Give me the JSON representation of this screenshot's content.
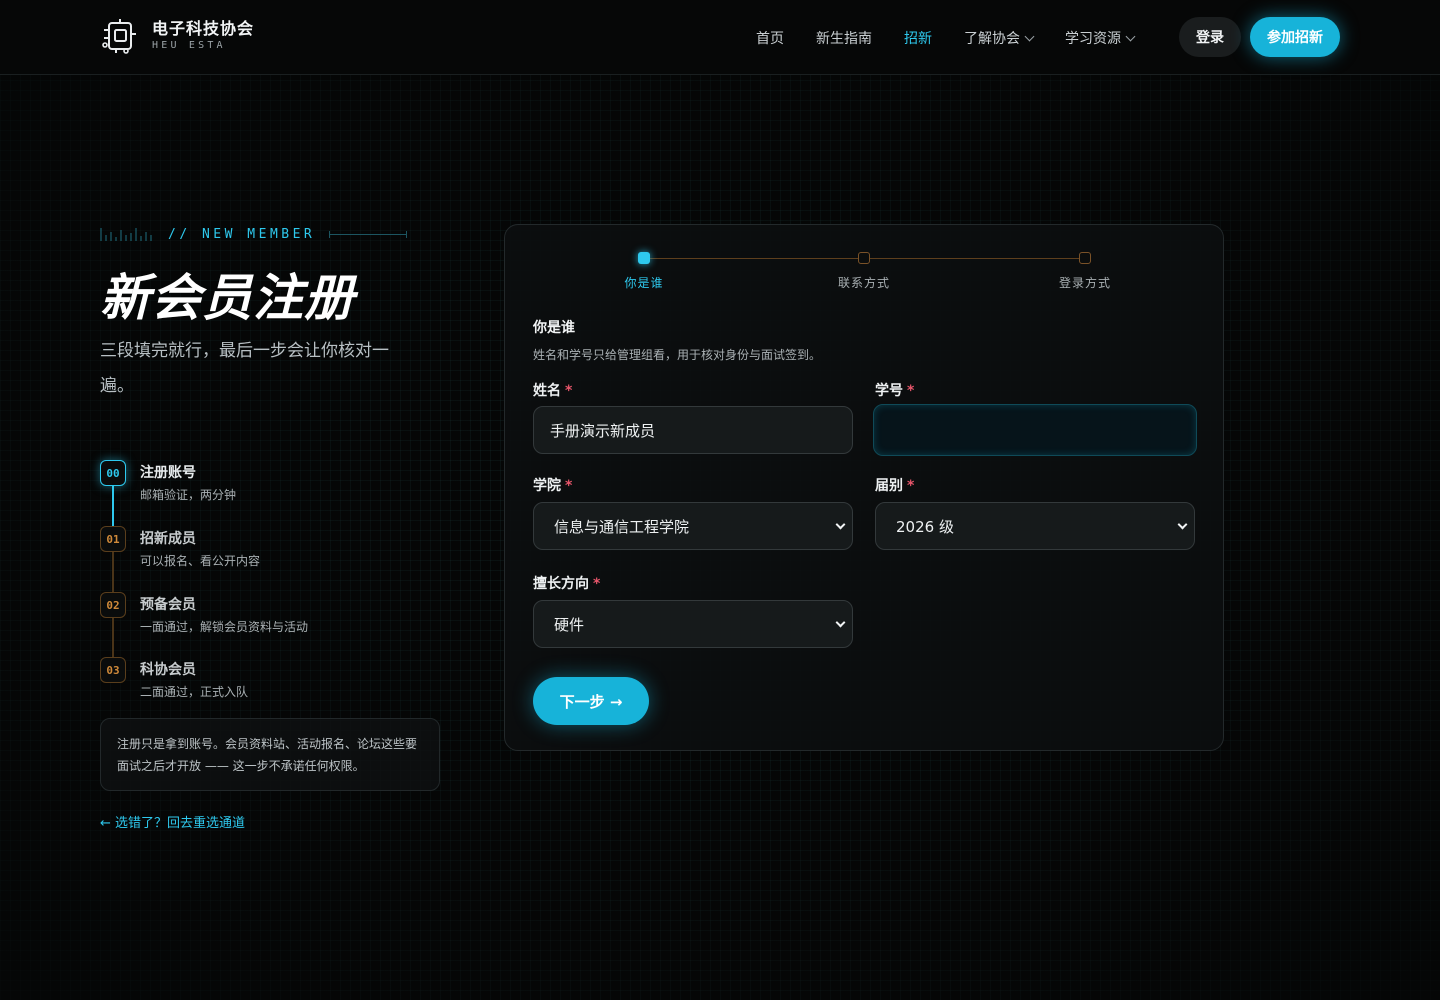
{
  "header": {
    "logo_title": "电子科技协会",
    "logo_sub": "HEU ESTA",
    "nav": [
      {
        "label": "首页",
        "active": false
      },
      {
        "label": "新生指南",
        "active": false
      },
      {
        "label": "招新",
        "active": true
      },
      {
        "label": "了解协会",
        "dropdown": true
      },
      {
        "label": "学习资源",
        "dropdown": true
      }
    ],
    "login_label": "登录",
    "join_label": "参加招新"
  },
  "intro": {
    "eyebrow": "// NEW MEMBER",
    "title": "新会员注册",
    "subtitle": "三段填完就行，最后一步会让你核对一遍。"
  },
  "steps": [
    {
      "badge": "00",
      "title": "注册账号",
      "desc": "邮箱验证，两分钟",
      "state": "active"
    },
    {
      "badge": "01",
      "title": "招新成员",
      "desc": "可以报名、看公开内容",
      "state": "pending"
    },
    {
      "badge": "02",
      "title": "预备会员",
      "desc": "一面通过，解锁会员资料与活动",
      "state": "pending"
    },
    {
      "badge": "03",
      "title": "科协会员",
      "desc": "二面通过，正式入队",
      "state": "pending"
    }
  ],
  "note": "注册只是拿到账号。会员资料站、活动报名、论坛这些要面试之后才开放 —— 这一步不承诺任何权限。",
  "back_link": "← 选错了？回去重选通道",
  "form": {
    "progress": [
      {
        "label": "你是谁",
        "state": "done"
      },
      {
        "label": "联系方式",
        "state": "todo"
      },
      {
        "label": "登录方式",
        "state": "todo"
      }
    ],
    "section_title": "你是谁",
    "section_desc": "姓名和学号只给管理组看，用于核对身份与面试签到。",
    "required_mark": "*",
    "fields": {
      "name": {
        "label": "姓名",
        "value": "手册演示新成员"
      },
      "student_id": {
        "label": "学号",
        "value": ""
      },
      "college": {
        "label": "学院",
        "value": "信息与通信工程学院"
      },
      "grade": {
        "label": "届别",
        "value": "2026 级"
      },
      "direction": {
        "label": "擅长方向",
        "value": "硬件"
      }
    },
    "next_label": "下一步 →"
  },
  "colors": {
    "accent": "#17b3d9",
    "accent_text": "#2ec9ee",
    "pending": "#d08a3a",
    "required": "#e8566b",
    "background": "#050606"
  },
  "icons": {
    "logo": "circuit-board-icon",
    "dropdown": "chevron-down-icon"
  }
}
